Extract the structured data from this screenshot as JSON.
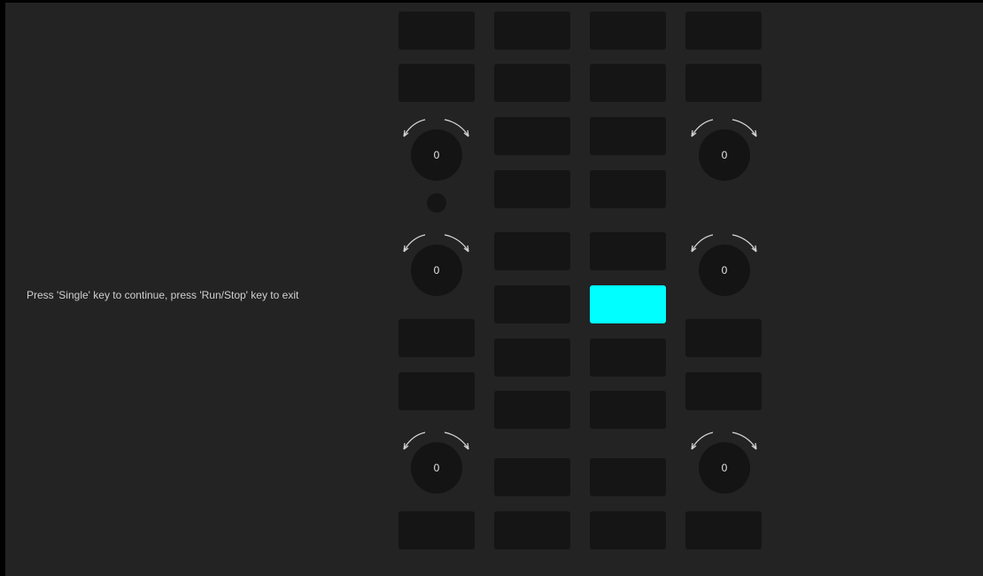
{
  "instruction": "Press 'Single' key to continue, press 'Run/Stop' key to exit",
  "knobs": [
    {
      "value": "0"
    },
    {
      "value": "0"
    },
    {
      "value": "0"
    },
    {
      "value": "0"
    },
    {
      "value": "0"
    },
    {
      "value": "0"
    }
  ],
  "colors": {
    "background": "#232323",
    "key": "#151515",
    "highlighted_key": "#00ffff"
  }
}
